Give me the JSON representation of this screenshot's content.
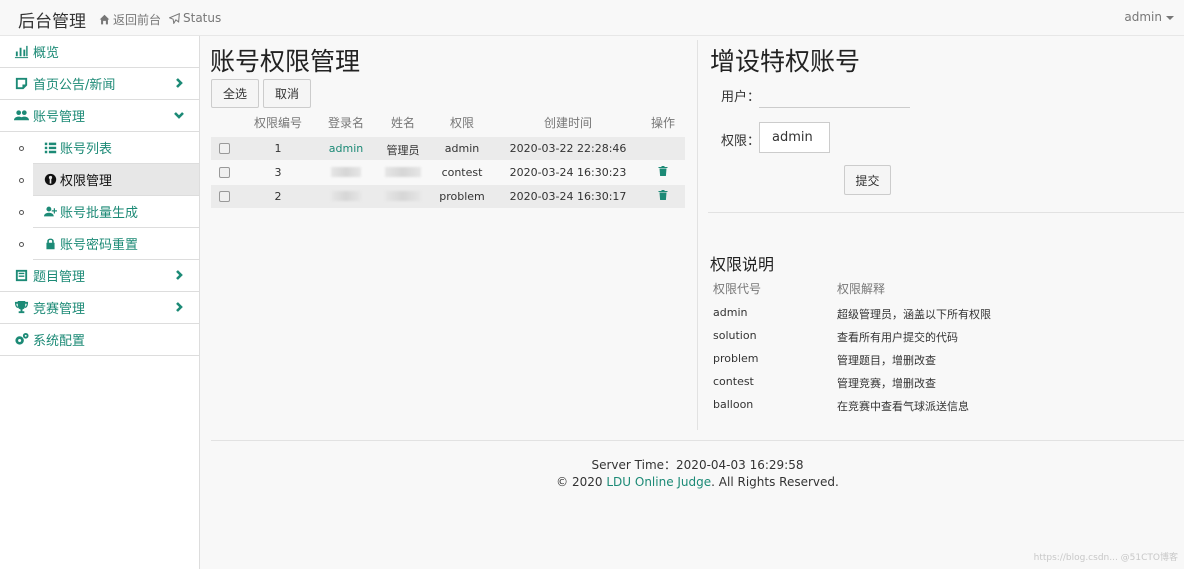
{
  "navbar": {
    "brand": "后台管理",
    "back_link": "返回前台",
    "status_link": "Status",
    "user": "admin"
  },
  "sidebar": {
    "items": [
      {
        "label": "概览",
        "icon": "bar-chart-icon"
      },
      {
        "label": "首页公告/新闻",
        "icon": "note-icon"
      },
      {
        "label": "账号管理",
        "icon": "users-icon"
      },
      {
        "label": "题目管理",
        "icon": "list-icon"
      },
      {
        "label": "竞赛管理",
        "icon": "trophy-icon"
      },
      {
        "label": "系统配置",
        "icon": "gears-icon"
      }
    ],
    "subitems": [
      {
        "label": "账号列表",
        "icon": "list-icon"
      },
      {
        "label": "权限管理",
        "icon": "key-icon"
      },
      {
        "label": "账号批量生成",
        "icon": "user-plus-icon"
      },
      {
        "label": "账号密码重置",
        "icon": "lock-icon"
      }
    ]
  },
  "main": {
    "title": "账号权限管理",
    "select_all": "全选",
    "cancel": "取消",
    "table": {
      "columns": [
        "权限编号",
        "登录名",
        "姓名",
        "权限",
        "创建时间",
        "操作"
      ],
      "rows": [
        {
          "id": "1",
          "login": "admin",
          "name": "管理员",
          "permission": "admin",
          "created": "2020-03-22 22:28:46"
        },
        {
          "id": "3",
          "login": "",
          "name": "",
          "permission": "contest",
          "created": "2020-03-24 16:30:23"
        },
        {
          "id": "2",
          "login": "",
          "name": "",
          "permission": "problem",
          "created": "2020-03-24 16:30:17"
        }
      ]
    }
  },
  "right": {
    "title": "增设特权账号",
    "user_label": "用户：",
    "perm_label": "权限：",
    "perm_value": "admin",
    "submit": "提交",
    "section_title": "权限说明",
    "perm_table": {
      "head": [
        "权限代号",
        "权限解释"
      ],
      "rows": [
        [
          "admin",
          "超级管理员，涵盖以下所有权限"
        ],
        [
          "solution",
          "查看所有用户提交的代码"
        ],
        [
          "problem",
          "管理题目，增删改查"
        ],
        [
          "contest",
          "管理竞赛，增删改查"
        ],
        [
          "balloon",
          "在竞赛中查看气球派送信息"
        ]
      ]
    }
  },
  "footer": {
    "server_time": "Server Time：2020-04-03 16:29:58",
    "copyright_prefix": "© 2020 ",
    "oj_name": "LDU Online Judge",
    "copyright_suffix": ". All Rights Reserved."
  },
  "watermark": "https://blog.csdn... @51CTO博客",
  "colors": {
    "accent": "#1c8a76",
    "background": "#f8f8f8"
  }
}
